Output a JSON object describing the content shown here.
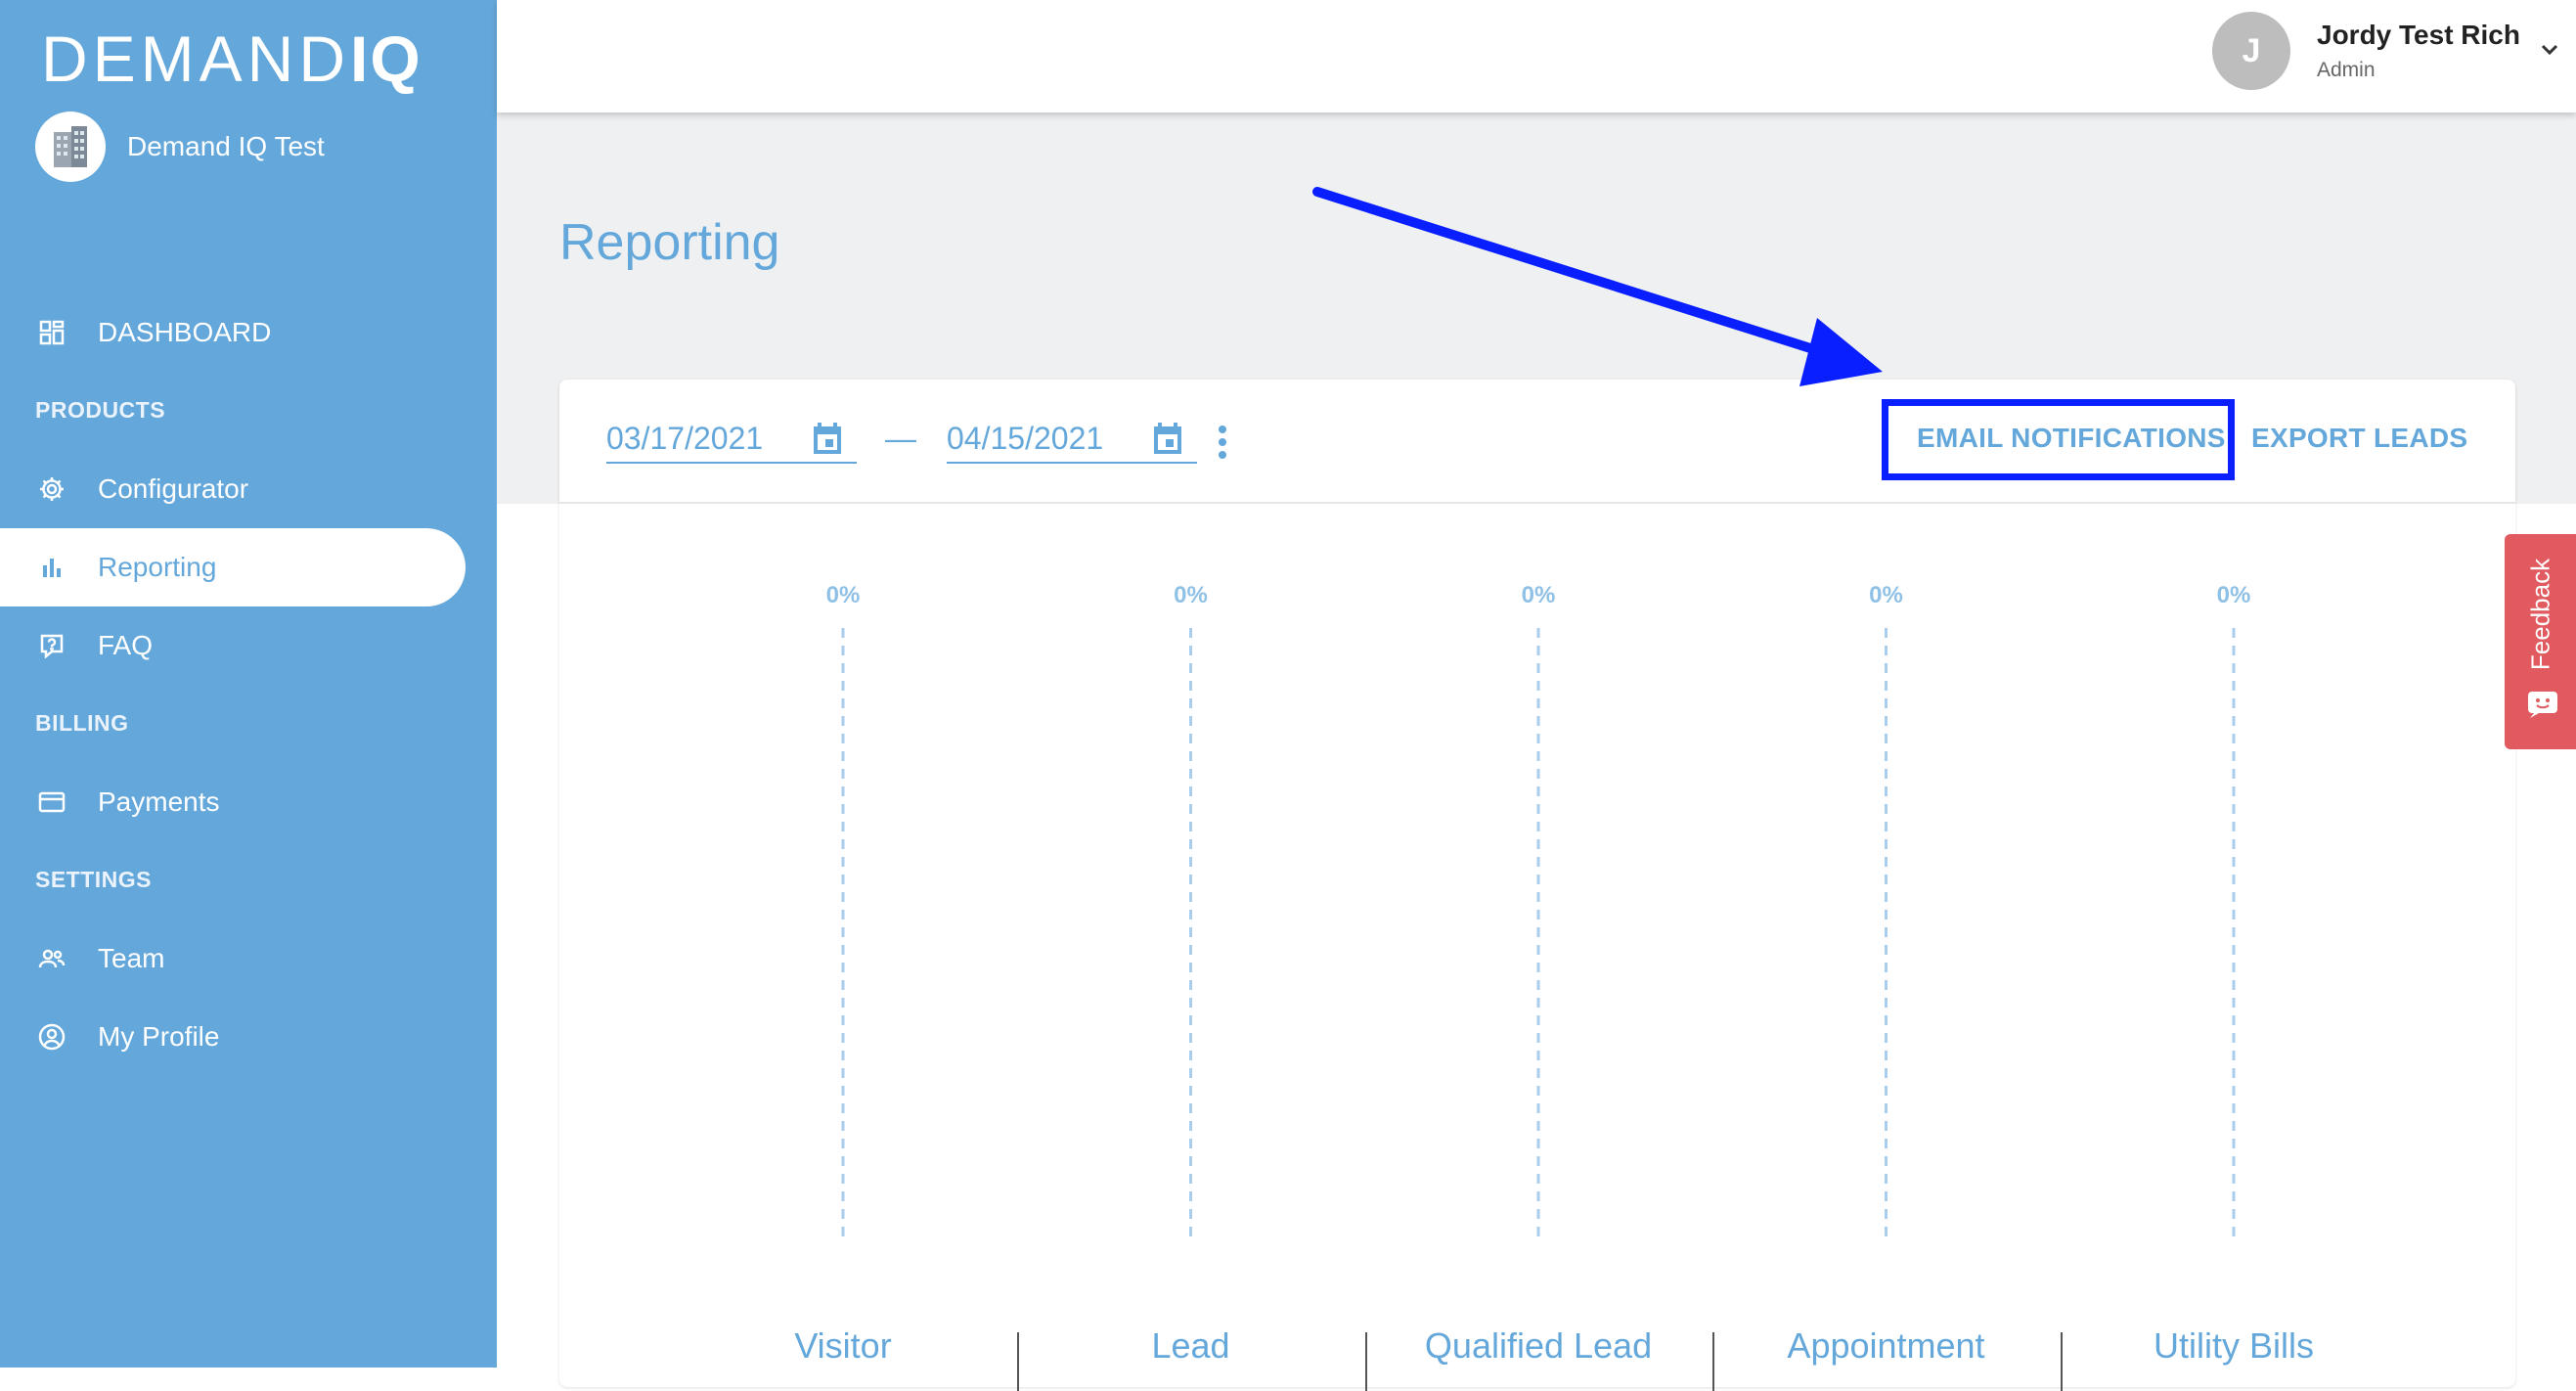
{
  "sidebar": {
    "logo": {
      "light": "DEMAND",
      "bold": "IQ"
    },
    "org": {
      "name": "Demand IQ Test",
      "icon": "building-icon"
    },
    "items": {
      "dashboard": {
        "label": "DASHBOARD",
        "icon": "grid-icon"
      },
      "products_header": "PRODUCTS",
      "configurator": {
        "label": "Configurator",
        "icon": "gear-icon"
      },
      "reporting": {
        "label": "Reporting",
        "icon": "bar-chart-icon",
        "active": true
      },
      "faq": {
        "label": "FAQ",
        "icon": "help-icon"
      },
      "billing_header": "BILLING",
      "payments": {
        "label": "Payments",
        "icon": "credit-card-icon"
      },
      "settings_header": "SETTINGS",
      "team": {
        "label": "Team",
        "icon": "people-icon"
      },
      "profile": {
        "label": "My Profile",
        "icon": "user-circle-icon"
      }
    }
  },
  "header": {
    "user": {
      "initial": "J",
      "name": "Jordy Test Rich",
      "role": "Admin",
      "menu_icon": "chevron-down-icon"
    }
  },
  "page": {
    "title": "Reporting"
  },
  "toolbar": {
    "start_date": "03/17/2021",
    "end_date": "04/15/2021",
    "separator": "—",
    "email_notifications": "EMAIL NOTIFICATIONS",
    "export_leads": "EXPORT LEADS"
  },
  "chart_data": {
    "type": "bar",
    "categories": [
      "Visitor",
      "Lead",
      "Qualified Lead",
      "Appointment",
      "Utility Bills"
    ],
    "values": [
      0,
      0,
      0,
      0,
      0
    ],
    "data_labels": [
      "0%",
      "0%",
      "0%",
      "0%",
      "0%"
    ],
    "title": "",
    "xlabel": "",
    "ylabel": ""
  },
  "feedback": {
    "label": "Feedback"
  },
  "colors": {
    "sidebar": "#64a7da",
    "accent": "#64a7da",
    "highlight": "#0a1fff",
    "feedback": "#e05a5f"
  }
}
